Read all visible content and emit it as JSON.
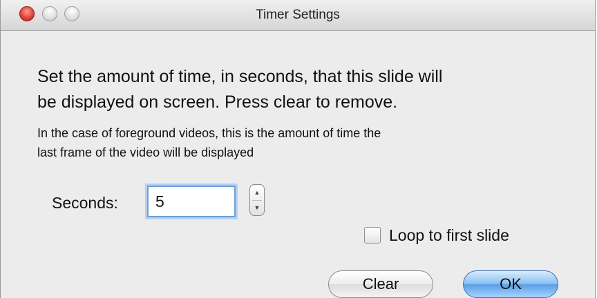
{
  "window": {
    "title": "Timer Settings"
  },
  "dialog": {
    "main_text_line1": "Set the amount of time, in seconds, that this slide will",
    "main_text_line2": "be displayed on screen. Press clear to remove.",
    "sub_text_line1": "In the case of foreground videos, this is the amount of time the",
    "sub_text_line2": "last frame of the video will be displayed"
  },
  "seconds": {
    "label": "Seconds:",
    "value": "5"
  },
  "loop": {
    "label": "Loop to first slide",
    "checked": false
  },
  "buttons": {
    "clear_label": "Clear",
    "ok_label": "OK"
  },
  "colors": {
    "close_button": "#e0443a",
    "focus_ring": "#6f9fd8",
    "default_button": "#5a9ee5"
  }
}
